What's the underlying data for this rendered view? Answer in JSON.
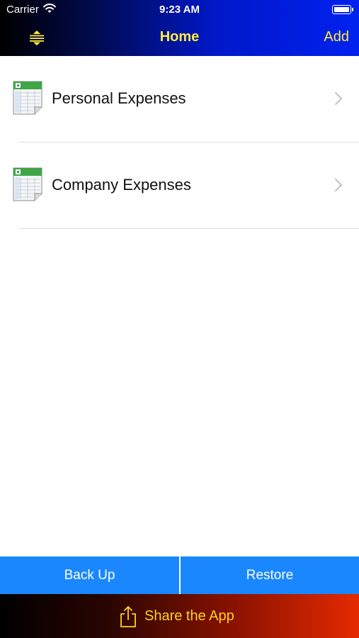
{
  "status_bar": {
    "carrier": "Carrier",
    "time": "9:23 AM"
  },
  "nav_bar": {
    "title": "Home",
    "add_label": "Add",
    "accent_color": "#ffec3c",
    "menu_icon": "sort-arrows-icon"
  },
  "list": {
    "items": [
      {
        "label": "Personal Expenses",
        "icon": "spreadsheet-icon"
      },
      {
        "label": "Company Expenses",
        "icon": "spreadsheet-icon"
      }
    ]
  },
  "bottom_buttons": {
    "backup_label": "Back Up",
    "restore_label": "Restore",
    "color": "#1a87ff"
  },
  "share": {
    "label": "Share the App",
    "icon": "share-icon",
    "color": "#ffd21a"
  }
}
